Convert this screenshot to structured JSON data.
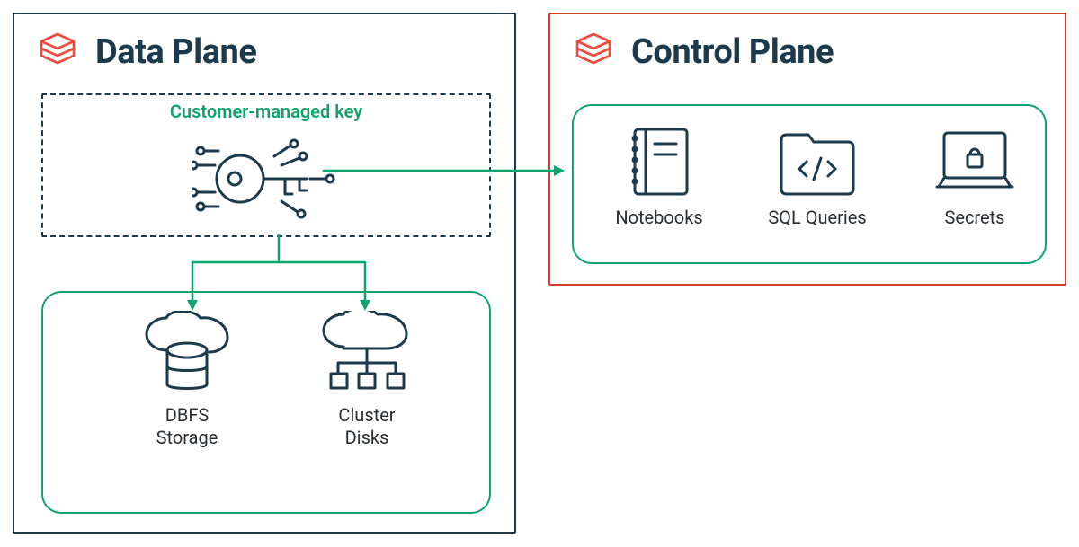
{
  "data_plane": {
    "title": "Data Plane",
    "cmk_label": "Customer-managed key",
    "items": [
      {
        "label": "DBFS\nStorage"
      },
      {
        "label": "Cluster\nDisks"
      }
    ]
  },
  "control_plane": {
    "title": "Control Plane",
    "items": [
      {
        "label": "Notebooks"
      },
      {
        "label": "SQL Queries"
      },
      {
        "label": "Secrets"
      }
    ]
  },
  "colors": {
    "border_navy": "#1b3a4b",
    "green": "#0fa36b",
    "red": "#d83a2b",
    "icon_red": "#ee4b3e",
    "icon_navy": "#1b3a4b"
  }
}
